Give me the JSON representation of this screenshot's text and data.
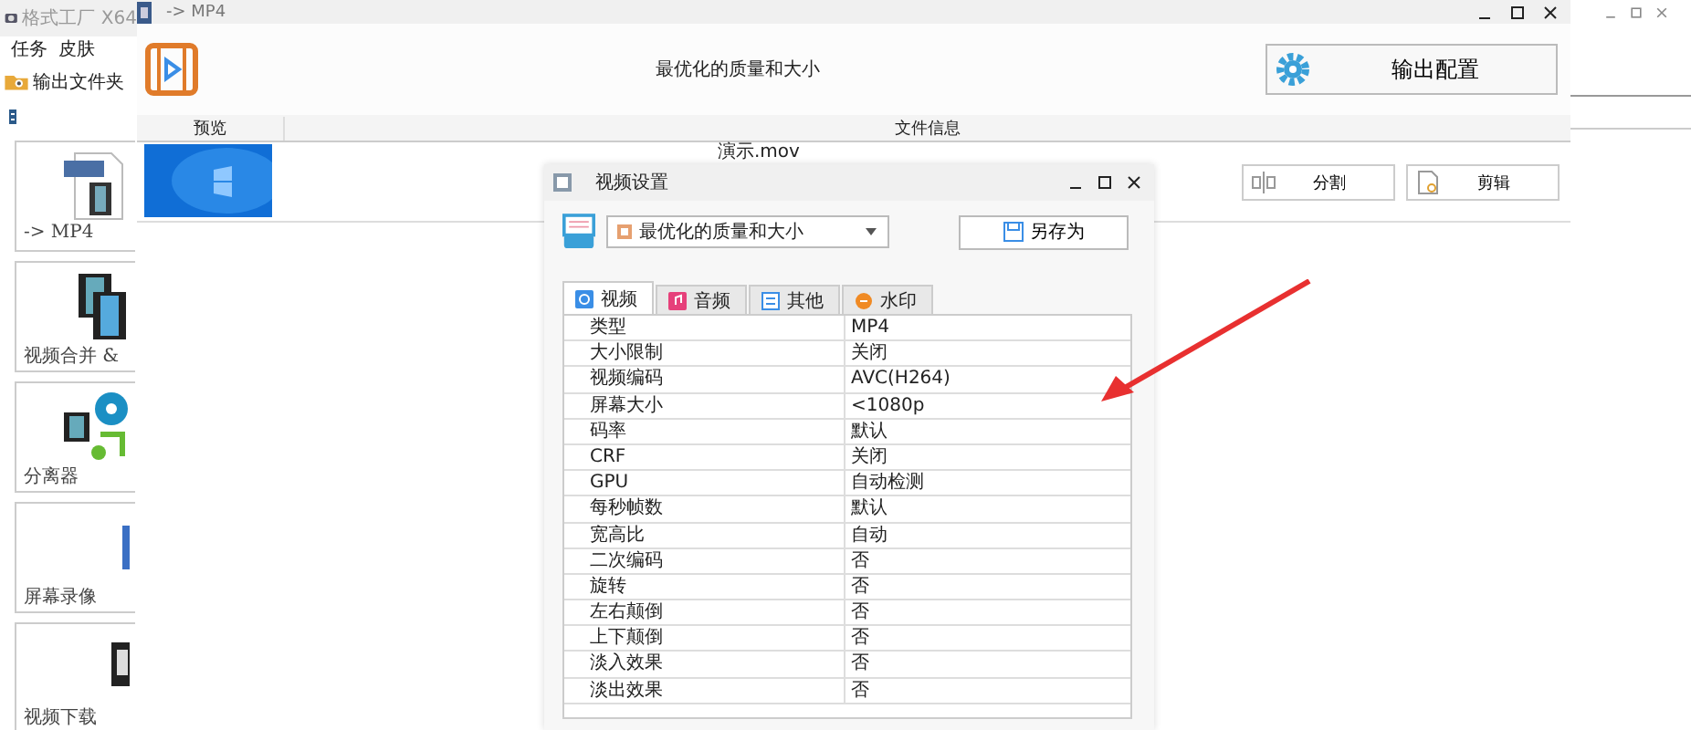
{
  "main_window": {
    "title": "格式工厂 X64",
    "menu": [
      "任务",
      "皮肤"
    ],
    "output_folder": "输出文件夹",
    "sidebar": [
      {
        "label": "-> MP4",
        "kind": "mp4"
      },
      {
        "label": "视频合并 &",
        "kind": "merge"
      },
      {
        "label": "分离器",
        "kind": "splitter"
      },
      {
        "label": "屏幕录像",
        "kind": "record"
      },
      {
        "label": "视频下载",
        "kind": "download"
      }
    ]
  },
  "convert_window": {
    "title": "-> MP4",
    "profile": "最优化的质量和大小",
    "output_button": "输出配置",
    "table": {
      "columns": [
        "预览",
        "文件信息"
      ],
      "rows": [
        {
          "file": "演示.mov"
        }
      ]
    },
    "buttons": [
      {
        "label": "分割",
        "kind": "split"
      },
      {
        "label": "剪辑",
        "kind": "clip"
      }
    ]
  },
  "settings_dialog": {
    "title": "视频设置",
    "preset": "最优化的质量和大小",
    "save_as": "另存为",
    "tabs": [
      {
        "label": "视频",
        "kind": "video",
        "selected": true
      },
      {
        "label": "音频",
        "kind": "audio",
        "selected": false
      },
      {
        "label": "其他",
        "kind": "other",
        "selected": false
      },
      {
        "label": "水印",
        "kind": "watermark",
        "selected": false
      }
    ],
    "properties": [
      {
        "name": "类型",
        "value": "MP4"
      },
      {
        "name": "大小限制",
        "value": "关闭"
      },
      {
        "name": "视频编码",
        "value": "AVC(H264)"
      },
      {
        "name": "屏幕大小",
        "value": "<1080p"
      },
      {
        "name": "码率",
        "value": "默认"
      },
      {
        "name": "CRF",
        "value": "关闭"
      },
      {
        "name": "GPU",
        "value": "自动检测"
      },
      {
        "name": "每秒帧数",
        "value": "默认"
      },
      {
        "name": "宽高比",
        "value": "自动"
      },
      {
        "name": "二次编码",
        "value": "否"
      },
      {
        "name": "旋转",
        "value": "否"
      },
      {
        "name": "左右颠倒",
        "value": "否"
      },
      {
        "name": "上下颠倒",
        "value": "否"
      },
      {
        "name": "淡入效果",
        "value": "否"
      },
      {
        "name": "淡出效果",
        "value": "否"
      }
    ]
  }
}
